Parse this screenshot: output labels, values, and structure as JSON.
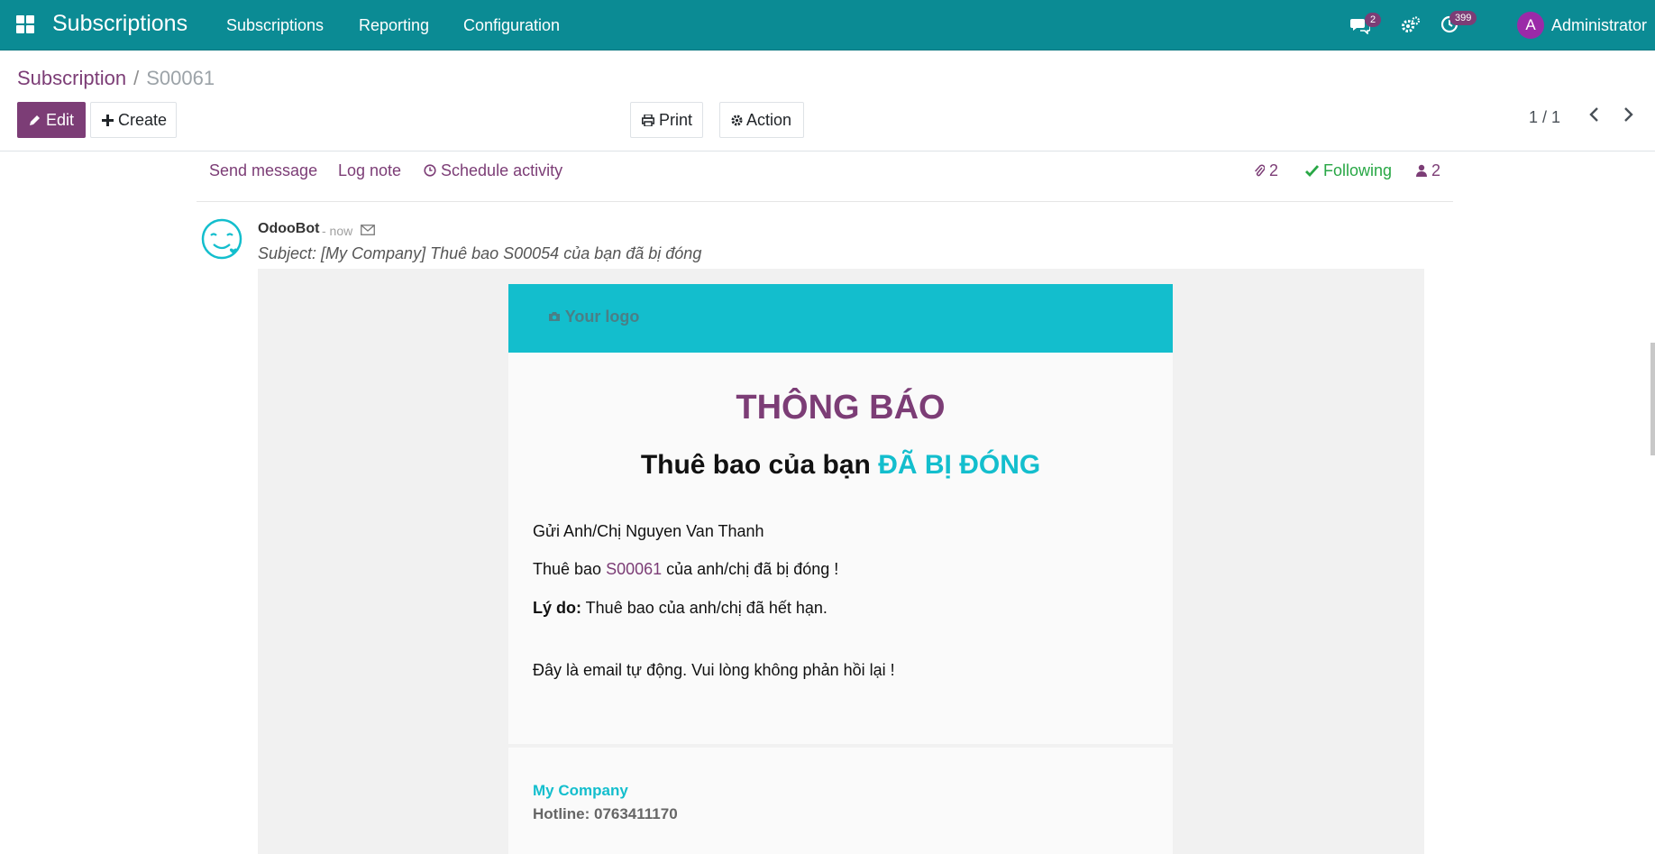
{
  "navbar": {
    "brand": "Subscriptions",
    "menu": [
      "Subscriptions",
      "Reporting",
      "Configuration"
    ],
    "messages_count": "2",
    "activities_count": "399",
    "user_initial": "A",
    "user_name": "Administrator"
  },
  "breadcrumb": {
    "parent": "Subscription",
    "separator": "/",
    "current": "S00061"
  },
  "toolbar": {
    "edit_label": "Edit",
    "create_label": "Create",
    "print_label": "Print",
    "action_label": "Action"
  },
  "pager": {
    "value": "1 / 1"
  },
  "chatter": {
    "send_message": "Send message",
    "log_note": "Log note",
    "schedule_activity": "Schedule activity",
    "attachments_count": "2",
    "following_label": "Following",
    "followers_count": "2"
  },
  "message": {
    "author": "OdooBot",
    "time": "- now",
    "subject": "Subject: [My Company] Thuê bao S00054 của bạn đã bị đóng"
  },
  "email": {
    "logo_text": "Your logo",
    "title": "THÔNG BÁO",
    "subtitle_prefix": "Thuê bao của bạn ",
    "subtitle_highlight": "ĐÃ BỊ ĐÓNG",
    "greeting": "Gửi Anh/Chị Nguyen Van Thanh",
    "line2_prefix": "Thuê bao ",
    "line2_ref": "S00061",
    "line2_suffix": " của anh/chị đã bị đóng !",
    "reason_label": "Lý do:",
    "reason_text": " Thuê bao của anh/chị đã hết hạn.",
    "auto_note": "Đây là email tự động. Vui lòng không phản hồi lại !",
    "company": "My Company",
    "hotline": "Hotline: 0763411170"
  },
  "colors": {
    "navbar": "#0b8b94",
    "primary": "#7c3d76",
    "accent": "#13becd",
    "following": "#28a745"
  },
  "icons": [
    "apps-icon",
    "chat-icon",
    "settings-icon",
    "activity-clock-icon",
    "pencil-icon",
    "plus-icon",
    "print-icon",
    "gear-icon",
    "chevron-left-icon",
    "chevron-right-icon",
    "paperclip-icon",
    "check-icon",
    "user-icon",
    "clock-icon",
    "envelope-icon",
    "camera-icon",
    "odoobot-avatar"
  ]
}
